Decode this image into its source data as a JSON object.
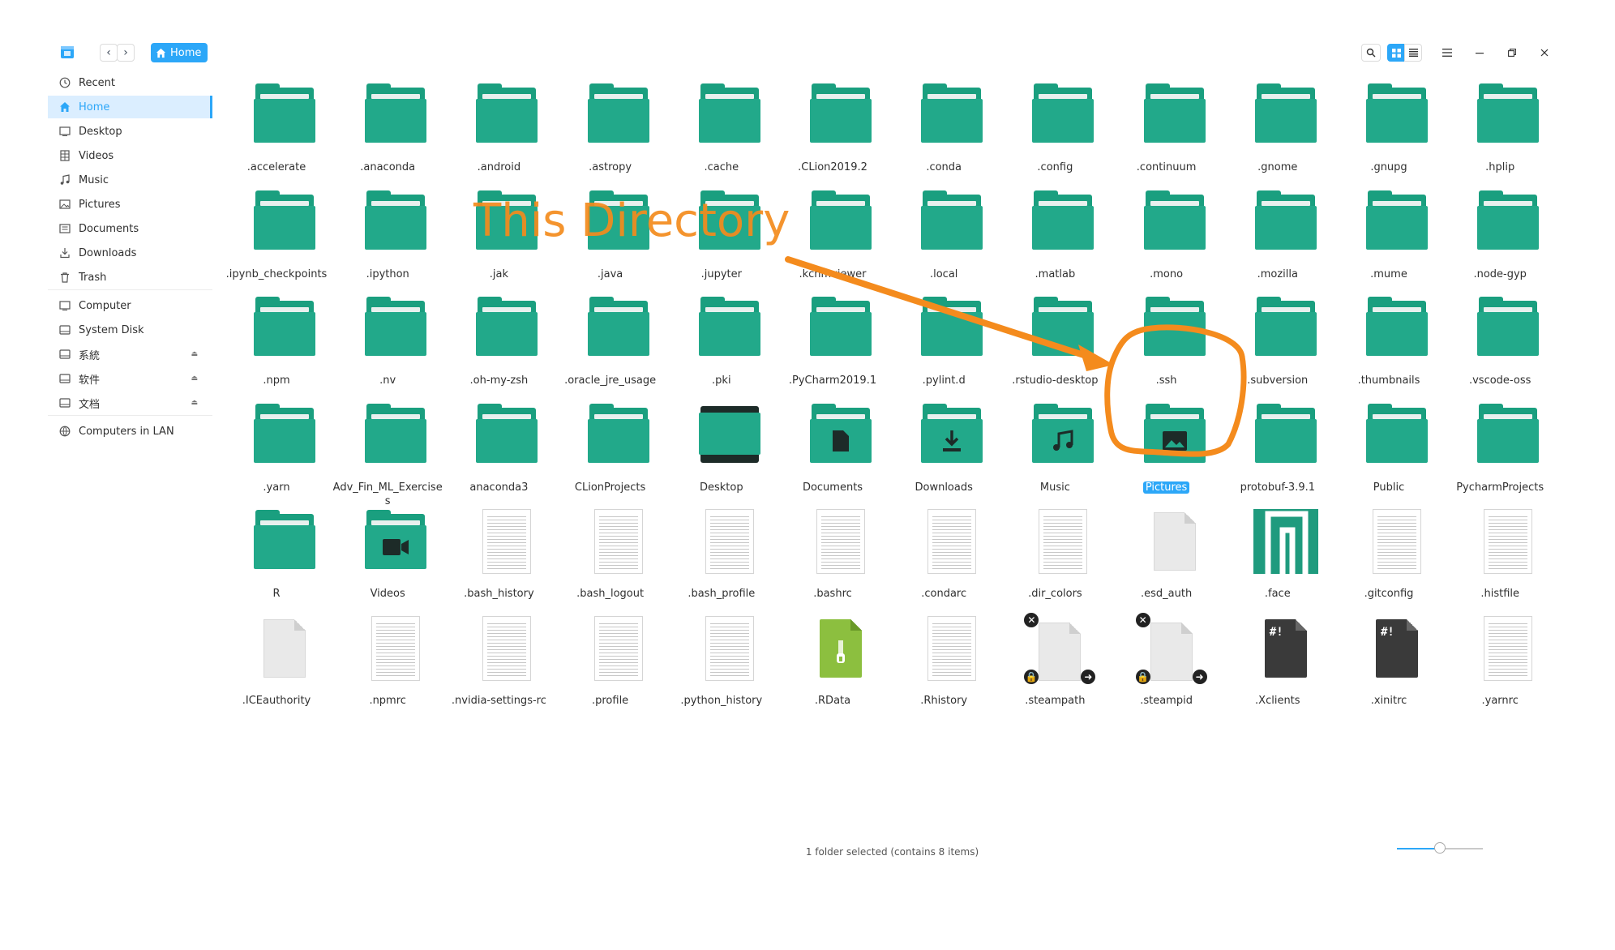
{
  "toolbar": {
    "back_icon": "chevron-left",
    "forward_icon": "chevron-right",
    "breadcrumb": "Home",
    "search_icon": "search",
    "view_icon_grid": "grid",
    "view_icon_list": "list",
    "menu_icon": "hamburger"
  },
  "sidebar": {
    "items": [
      {
        "label": "Recent",
        "icon": "clock"
      },
      {
        "label": "Home",
        "icon": "home",
        "active": true
      },
      {
        "label": "Desktop",
        "icon": "desktop"
      },
      {
        "label": "Videos",
        "icon": "film"
      },
      {
        "label": "Music",
        "icon": "music"
      },
      {
        "label": "Pictures",
        "icon": "image"
      },
      {
        "label": "Documents",
        "icon": "document"
      },
      {
        "label": "Downloads",
        "icon": "download"
      },
      {
        "label": "Trash",
        "icon": "trash"
      }
    ],
    "devices": [
      {
        "label": "Computer",
        "icon": "computer"
      },
      {
        "label": "System Disk",
        "icon": "disk"
      },
      {
        "label": "系統",
        "icon": "disk",
        "eject": true
      },
      {
        "label": "软件",
        "icon": "disk",
        "eject": true
      },
      {
        "label": "文档",
        "icon": "disk",
        "eject": true
      }
    ],
    "network": [
      {
        "label": "Computers in LAN",
        "icon": "network"
      }
    ]
  },
  "files": [
    {
      "name": ".accelerate",
      "type": "folder"
    },
    {
      "name": ".anaconda",
      "type": "folder"
    },
    {
      "name": ".android",
      "type": "folder"
    },
    {
      "name": ".astropy",
      "type": "folder"
    },
    {
      "name": ".cache",
      "type": "folder"
    },
    {
      "name": ".CLion2019.2",
      "type": "folder"
    },
    {
      "name": ".conda",
      "type": "folder"
    },
    {
      "name": ".config",
      "type": "folder"
    },
    {
      "name": ".continuum",
      "type": "folder"
    },
    {
      "name": ".gnome",
      "type": "folder"
    },
    {
      "name": ".gnupg",
      "type": "folder"
    },
    {
      "name": ".hplip",
      "type": "folder"
    },
    {
      "name": ".ipynb_checkpoints",
      "type": "folder"
    },
    {
      "name": ".ipython",
      "type": "folder"
    },
    {
      "name": ".jak",
      "type": "folder"
    },
    {
      "name": ".java",
      "type": "folder"
    },
    {
      "name": ".jupyter",
      "type": "folder"
    },
    {
      "name": ".kchmviewer",
      "type": "folder"
    },
    {
      "name": ".local",
      "type": "folder"
    },
    {
      "name": ".matlab",
      "type": "folder"
    },
    {
      "name": ".mono",
      "type": "folder"
    },
    {
      "name": ".mozilla",
      "type": "folder"
    },
    {
      "name": ".mume",
      "type": "folder"
    },
    {
      "name": ".node-gyp",
      "type": "folder"
    },
    {
      "name": ".npm",
      "type": "folder"
    },
    {
      "name": ".nv",
      "type": "folder"
    },
    {
      "name": ".oh-my-zsh",
      "type": "folder"
    },
    {
      "name": ".oracle_jre_usage",
      "type": "folder"
    },
    {
      "name": ".pki",
      "type": "folder"
    },
    {
      "name": ".PyCharm2019.1",
      "type": "folder"
    },
    {
      "name": ".pylint.d",
      "type": "folder"
    },
    {
      "name": ".rstudio-desktop",
      "type": "folder"
    },
    {
      "name": ".ssh",
      "type": "folder"
    },
    {
      "name": ".subversion",
      "type": "folder"
    },
    {
      "name": ".thumbnails",
      "type": "folder"
    },
    {
      "name": ".vscode-oss",
      "type": "folder"
    },
    {
      "name": ".yarn",
      "type": "folder"
    },
    {
      "name": "Adv_Fin_ML_Exercises",
      "type": "folder"
    },
    {
      "name": "anaconda3",
      "type": "folder"
    },
    {
      "name": "CLionProjects",
      "type": "folder"
    },
    {
      "name": "Desktop",
      "type": "folder",
      "emblem": "desktop"
    },
    {
      "name": "Documents",
      "type": "folder",
      "emblem": "document"
    },
    {
      "name": "Downloads",
      "type": "folder",
      "emblem": "download"
    },
    {
      "name": "Music",
      "type": "folder",
      "emblem": "music"
    },
    {
      "name": "Pictures",
      "type": "folder",
      "emblem": "image",
      "selected": true
    },
    {
      "name": "protobuf-3.9.1",
      "type": "folder"
    },
    {
      "name": "Public",
      "type": "folder"
    },
    {
      "name": "PycharmProjects",
      "type": "folder"
    },
    {
      "name": "R",
      "type": "folder"
    },
    {
      "name": "Videos",
      "type": "folder",
      "emblem": "video"
    },
    {
      "name": ".bash_history",
      "type": "text"
    },
    {
      "name": ".bash_logout",
      "type": "text"
    },
    {
      "name": ".bash_profile",
      "type": "text"
    },
    {
      "name": ".bashrc",
      "type": "text"
    },
    {
      "name": ".condarc",
      "type": "text"
    },
    {
      "name": ".dir_colors",
      "type": "text"
    },
    {
      "name": ".esd_auth",
      "type": "blank"
    },
    {
      "name": ".face",
      "type": "image"
    },
    {
      "name": ".gitconfig",
      "type": "text"
    },
    {
      "name": ".histfile",
      "type": "text"
    },
    {
      "name": ".ICEauthority",
      "type": "blank"
    },
    {
      "name": ".npmrc",
      "type": "text"
    },
    {
      "name": ".nvidia-settings-rc",
      "type": "text"
    },
    {
      "name": ".profile",
      "type": "text"
    },
    {
      "name": ".python_history",
      "type": "text"
    },
    {
      "name": ".RData",
      "type": "rdata"
    },
    {
      "name": ".Rhistory",
      "type": "text"
    },
    {
      "name": ".steampath",
      "type": "broken-link"
    },
    {
      "name": ".steampid",
      "type": "broken-link"
    },
    {
      "name": ".Xclients",
      "type": "exec"
    },
    {
      "name": ".xinitrc",
      "type": "exec"
    },
    {
      "name": ".yarnrc",
      "type": "text"
    }
  ],
  "status": "1 folder selected (contains 8 items)",
  "zoom_fraction": 0.5,
  "annotation": {
    "text": "This Directory",
    "color": "#f48b1d"
  },
  "colors": {
    "accent": "#2ca7f8",
    "folder": "#1a9f7f"
  }
}
